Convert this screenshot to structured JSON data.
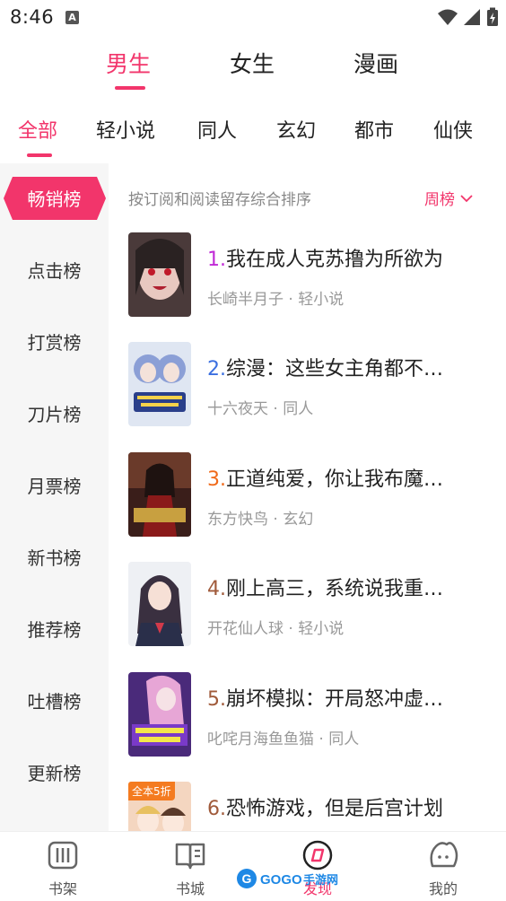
{
  "status_bar": {
    "time": "8:46",
    "notification_letter": "A"
  },
  "gender_tabs": [
    {
      "label": "男生",
      "active": true
    },
    {
      "label": "女生",
      "active": false
    },
    {
      "label": "漫画",
      "active": false
    }
  ],
  "category_tabs": [
    {
      "label": "全部",
      "active": true
    },
    {
      "label": "轻小说",
      "active": false
    },
    {
      "label": "同人",
      "active": false
    },
    {
      "label": "玄幻",
      "active": false
    },
    {
      "label": "都市",
      "active": false
    },
    {
      "label": "仙侠",
      "active": false
    }
  ],
  "sidebar": {
    "items": [
      {
        "label": "畅销榜",
        "active": true
      },
      {
        "label": "点击榜",
        "active": false
      },
      {
        "label": "打赏榜",
        "active": false
      },
      {
        "label": "刀片榜",
        "active": false
      },
      {
        "label": "月票榜",
        "active": false
      },
      {
        "label": "新书榜",
        "active": false
      },
      {
        "label": "推荐榜",
        "active": false
      },
      {
        "label": "吐槽榜",
        "active": false
      },
      {
        "label": "更新榜",
        "active": false
      }
    ]
  },
  "list_header": {
    "description": "按订阅和阅读留存综合排序",
    "period": "周榜"
  },
  "books": [
    {
      "rank": "1.",
      "rank_color": "#c02ad6",
      "title": "我在成人克苏撸为所欲为",
      "meta": "长崎半月子 · 轻小说",
      "badge": ""
    },
    {
      "rank": "2.",
      "rank_color": "#3b6fe0",
      "title": "综漫：这些女主角都不…",
      "meta": "十六夜天 · 同人",
      "badge": ""
    },
    {
      "rank": "3.",
      "rank_color": "#f06a1a",
      "title": "正道纯爱，你让我布魔…",
      "meta": "东方快鸟 · 玄幻",
      "badge": ""
    },
    {
      "rank": "4.",
      "rank_color": "#a05a3a",
      "title": "刚上高三，系统说我重…",
      "meta": "开花仙人球 · 轻小说",
      "badge": ""
    },
    {
      "rank": "5.",
      "rank_color": "#a05a3a",
      "title": "崩坏模拟：开局怒冲虚…",
      "meta": "叱咤月海鱼鱼猫 · 同人",
      "badge": ""
    },
    {
      "rank": "6.",
      "rank_color": "#a05a3a",
      "title": "恐怖游戏，但是后宫计划",
      "meta": "",
      "badge": "全本5折"
    }
  ],
  "bottom_nav": [
    {
      "label": "书架",
      "active": false
    },
    {
      "label": "书城",
      "active": false
    },
    {
      "label": "发现",
      "active": true
    },
    {
      "label": "我的",
      "active": false
    }
  ],
  "watermark": {
    "text": "GOGO手游网"
  },
  "colors": {
    "accent": "#f2356b",
    "sidebar_bg": "#f6f6f6"
  }
}
